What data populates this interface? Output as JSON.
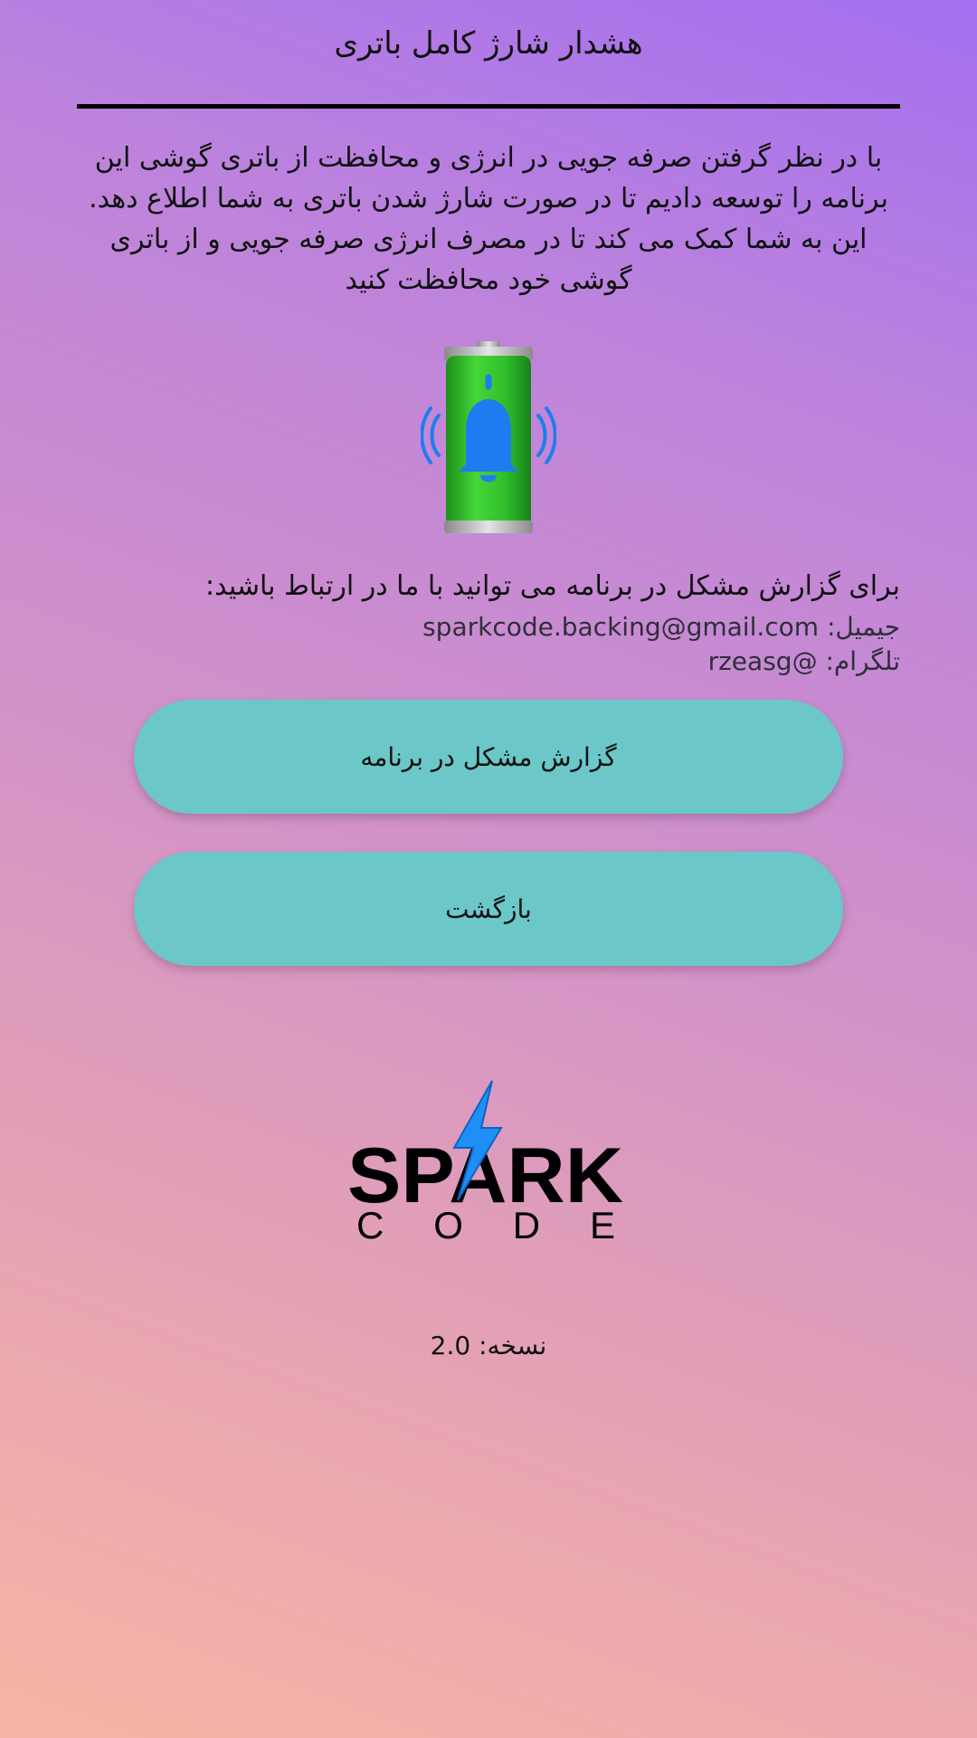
{
  "header": {
    "title": "هشدار شارژ کامل باتری"
  },
  "intro": {
    "text": "با در نظر گرفتن صرفه جویی در انرژی و محافظت از باتری گوشی این برنامه را توسعه دادیم تا در صورت شارژ شدن باتری به شما اطلاع دهد. این به شما کمک می کند تا در مصرف انرژی صرفه جویی و از باتری گوشی خود محافظت کنید"
  },
  "illustration": {
    "icon": "battery-bell-icon",
    "battery_color": "#2fbf2a",
    "bell_color": "#1f7cf0"
  },
  "contact": {
    "heading": "برای گزارش مشکل در برنامه می توانید با ما در ارتباط باشید:",
    "email": "جیمیل: sparkcode.backing@gmail.com",
    "telegram": "تلگرام: @rzeasg"
  },
  "buttons": {
    "report_label": "گزارش مشکل در برنامه",
    "back_label": "بازگشت",
    "color": "#6bc7c8"
  },
  "logo": {
    "word_top": "SPARK",
    "word_bottom": "C O D E",
    "accent_color": "#1f8ff7"
  },
  "footer": {
    "version": "نسخه: 2.0"
  }
}
